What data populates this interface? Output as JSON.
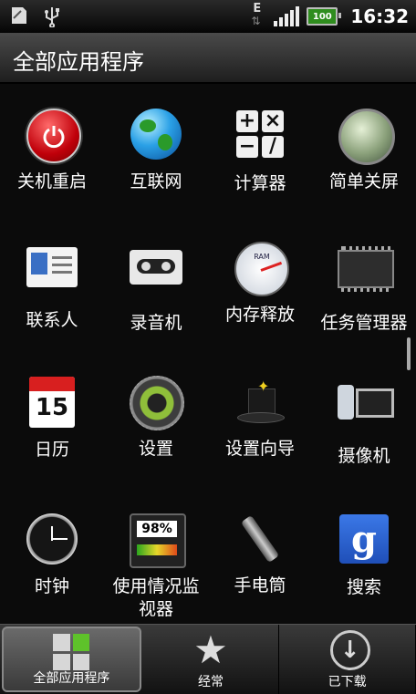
{
  "status_bar": {
    "left_icons": [
      "sd-card-icon",
      "usb-icon"
    ],
    "network_type": "E",
    "battery_level": "100",
    "time": "16:32",
    "colors": {
      "battery": "#2f8d1e"
    }
  },
  "title_bar": {
    "title": "全部应用程序"
  },
  "apps": [
    {
      "label": "关机重启",
      "icon": "power-icon"
    },
    {
      "label": "互联网",
      "icon": "globe-icon"
    },
    {
      "label": "计算器",
      "icon": "calculator-icon"
    },
    {
      "label": "简单关屏",
      "icon": "screen-off-orb-icon"
    },
    {
      "label": "联系人",
      "icon": "contacts-icon"
    },
    {
      "label": "录音机",
      "icon": "cassette-icon"
    },
    {
      "label": "内存释放",
      "icon": "ram-gauge-icon",
      "icon_text": "RAM"
    },
    {
      "label": "任务管理器",
      "icon": "chip-icon"
    },
    {
      "label": "日历",
      "icon": "calendar-icon",
      "icon_text": "15"
    },
    {
      "label": "设置",
      "icon": "gear-icon"
    },
    {
      "label": "设置向导",
      "icon": "magic-hat-icon"
    },
    {
      "label": "摄像机",
      "icon": "camcorder-icon"
    },
    {
      "label": "时钟",
      "icon": "clock-icon"
    },
    {
      "label": "使用情况监视器",
      "icon": "usage-monitor-icon",
      "icon_text": "98%"
    },
    {
      "label": "手电筒",
      "icon": "flashlight-icon"
    },
    {
      "label": "搜索",
      "icon": "google-search-icon",
      "icon_text": "g"
    }
  ],
  "tabs": [
    {
      "label": "全部应用程序",
      "icon": "all-apps-grid-icon",
      "active": true
    },
    {
      "label": "经常",
      "icon": "star-icon",
      "active": false
    },
    {
      "label": "已下载",
      "icon": "download-icon",
      "active": false
    }
  ]
}
